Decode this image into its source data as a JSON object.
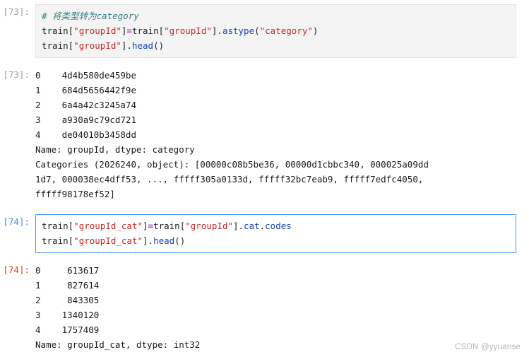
{
  "notebook": {
    "cells": [
      {
        "type": "code-input",
        "prompt": "[73]:",
        "lines": [
          {
            "tokens": [
              {
                "t": "comment",
                "s": "# 将类型转为category"
              }
            ]
          },
          {
            "tokens": [
              {
                "t": "plain",
                "s": "train"
              },
              {
                "t": "punc",
                "s": "["
              },
              {
                "t": "string",
                "s": "\"groupId\""
              },
              {
                "t": "punc",
                "s": "]"
              },
              {
                "t": "op",
                "s": "="
              },
              {
                "t": "plain",
                "s": "train"
              },
              {
                "t": "punc",
                "s": "["
              },
              {
                "t": "string",
                "s": "\"groupId\""
              },
              {
                "t": "punc",
                "s": "]."
              },
              {
                "t": "attr",
                "s": "astype"
              },
              {
                "t": "punc",
                "s": "("
              },
              {
                "t": "string",
                "s": "\"category\""
              },
              {
                "t": "punc",
                "s": ")"
              }
            ]
          },
          {
            "tokens": [
              {
                "t": "plain",
                "s": "train"
              },
              {
                "t": "punc",
                "s": "["
              },
              {
                "t": "string",
                "s": "\"groupId\""
              },
              {
                "t": "punc",
                "s": "]."
              },
              {
                "t": "attr",
                "s": "head"
              },
              {
                "t": "punc",
                "s": "()"
              }
            ]
          }
        ]
      },
      {
        "type": "code-output",
        "prompt": "[73]:",
        "lines": [
          "0    4d4b580de459be",
          "1    684d5656442f9e",
          "2    6a4a42c3245a74",
          "3    a930a9c79cd721",
          "4    de04010b3458dd",
          "Name: groupId, dtype: category",
          "Categories (2026240, object): [00000c08b5be36, 00000d1cbbc340, 000025a09dd",
          "1d7, 000038ec4dff53, ..., fffff305a0133d, fffff32bc7eab9, fffff7edfc4050,",
          "fffff98178ef52]"
        ]
      },
      {
        "type": "code-input",
        "prompt": "[74]:",
        "selected": true,
        "lines": [
          {
            "tokens": [
              {
                "t": "plain",
                "s": "train"
              },
              {
                "t": "punc",
                "s": "["
              },
              {
                "t": "string",
                "s": "\"groupId_cat\""
              },
              {
                "t": "punc",
                "s": "]"
              },
              {
                "t": "op",
                "s": "="
              },
              {
                "t": "plain",
                "s": "train"
              },
              {
                "t": "punc",
                "s": "["
              },
              {
                "t": "string",
                "s": "\"groupId\""
              },
              {
                "t": "punc",
                "s": "]."
              },
              {
                "t": "attr",
                "s": "cat"
              },
              {
                "t": "punc",
                "s": "."
              },
              {
                "t": "attr",
                "s": "codes"
              }
            ]
          },
          {
            "tokens": [
              {
                "t": "plain",
                "s": "train"
              },
              {
                "t": "punc",
                "s": "["
              },
              {
                "t": "string",
                "s": "\"groupId_cat\""
              },
              {
                "t": "punc",
                "s": "]."
              },
              {
                "t": "attr",
                "s": "head"
              },
              {
                "t": "punc",
                "s": "()"
              }
            ]
          }
        ]
      },
      {
        "type": "code-output",
        "prompt": "[74]:",
        "promptRed": true,
        "lines": [
          "0     613617",
          "1     827614",
          "2     843305",
          "3    1340120",
          "4    1757409",
          "Name: groupId_cat, dtype: int32"
        ]
      }
    ]
  },
  "watermark": {
    "text": "CSDN @yyuanse"
  },
  "colors": {
    "cell_background": "#f4f4f4",
    "cell_border": "#e3e3e3",
    "selected_border": "#4a9ae8",
    "selected_prompt": "#3f8ae0",
    "output_prompt_red": "#d84315",
    "prompt_gray": "#9e9e9e",
    "string_token": "#c62828",
    "operator_token": "#c230c2",
    "attribute_token": "#1544b8",
    "comment_token": "#3a7d7d",
    "text": "#202020",
    "watermark": "#b5b5b5"
  }
}
